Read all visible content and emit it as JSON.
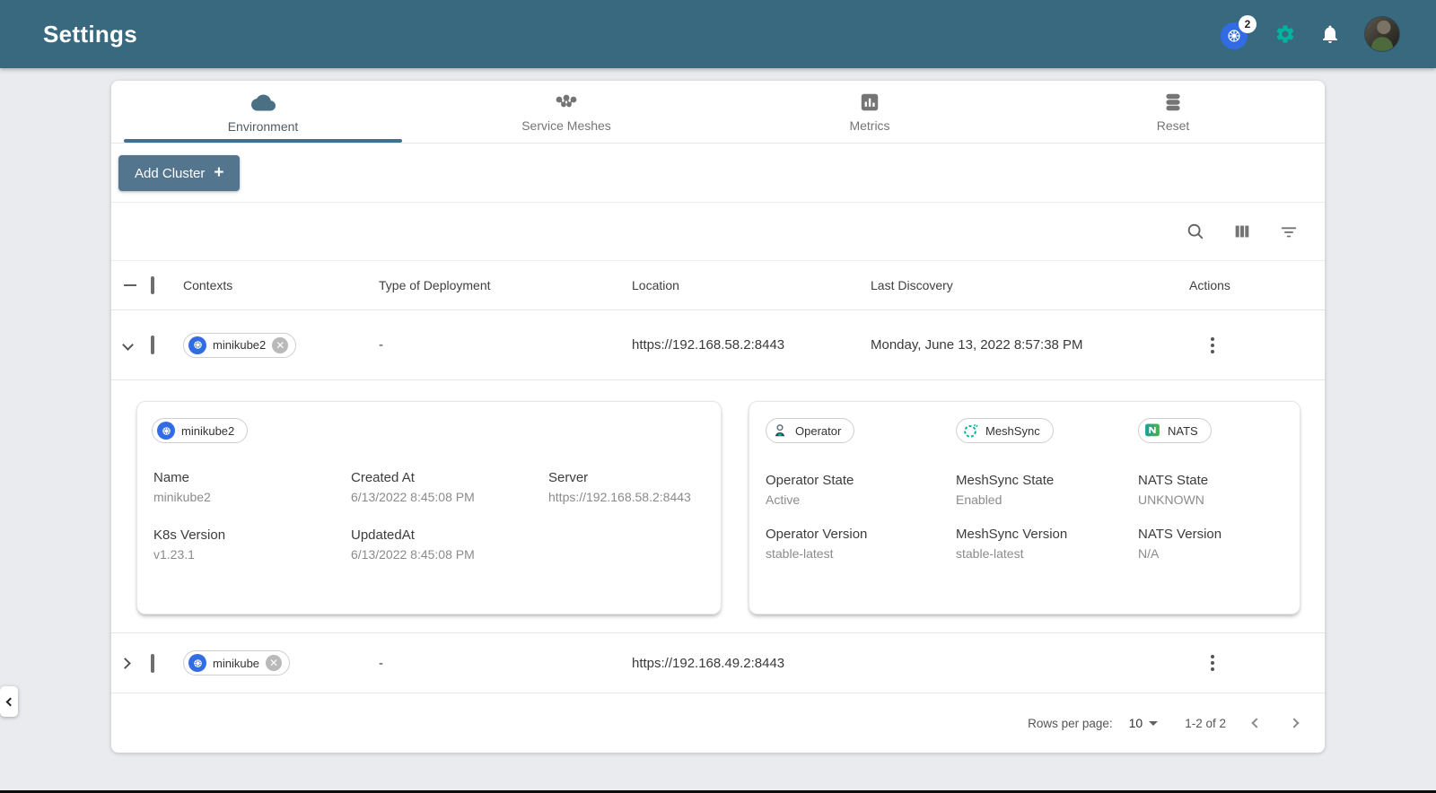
{
  "header": {
    "title": "Settings",
    "k8s_context_badge": "2"
  },
  "tabs": [
    {
      "label": "Environment",
      "active": true
    },
    {
      "label": "Service Meshes",
      "active": false
    },
    {
      "label": "Metrics",
      "active": false
    },
    {
      "label": "Reset",
      "active": false
    }
  ],
  "toolbar": {
    "add_cluster_label": "Add Cluster",
    "add_cluster_plus": "+"
  },
  "table": {
    "columns": [
      "Contexts",
      "Type of Deployment",
      "Location",
      "Last Discovery",
      "Actions"
    ],
    "rows": [
      {
        "context": "minikube2",
        "type_of_deployment": "-",
        "location": "https://192.168.58.2:8443",
        "last_discovery": "Monday, June 13, 2022 8:57:38 PM",
        "expanded": true
      },
      {
        "context": "minikube",
        "type_of_deployment": "-",
        "location": "https://192.168.49.2:8443",
        "last_discovery": "",
        "expanded": false
      }
    ]
  },
  "details": {
    "chip": "minikube2",
    "fields": [
      {
        "label": "Name",
        "value": "minikube2"
      },
      {
        "label": "Created At",
        "value": "6/13/2022 8:45:08 PM"
      },
      {
        "label": "Server",
        "value": "https://192.168.58.2:8443"
      },
      {
        "label": "K8s Version",
        "value": "v1.23.1"
      },
      {
        "label": "UpdatedAt",
        "value": "6/13/2022 8:45:08 PM"
      }
    ],
    "services": [
      {
        "chip": "Operator",
        "state_label": "Operator State",
        "state": "Active",
        "version_label": "Operator Version",
        "version": "stable-latest"
      },
      {
        "chip": "MeshSync",
        "state_label": "MeshSync State",
        "state": "Enabled",
        "version_label": "MeshSync Version",
        "version": "stable-latest"
      },
      {
        "chip": "NATS",
        "state_label": "NATS State",
        "state": "UNKNOWN",
        "version_label": "NATS Version",
        "version": "N/A"
      }
    ]
  },
  "pagination": {
    "rows_per_page_label": "Rows per page:",
    "rows_per_page": "10",
    "range": "1-2 of 2"
  },
  "icons": [
    "kubernetes-icon",
    "gear-icon",
    "bell-icon",
    "cloud-icon",
    "mesh-icon",
    "metrics-icon",
    "database-icon",
    "search-icon",
    "columns-icon",
    "filter-icon",
    "operator-icon",
    "meshsync-icon",
    "nats-icon",
    "kebab-icon",
    "close-icon"
  ],
  "colors": {
    "header_bg": "#38697e",
    "accent_teal": "#00B39F",
    "kubernetes_blue": "#326CE5",
    "nats_green": "#2BA362",
    "button_bg": "#53758e",
    "active_tab_underline": "#44708c"
  }
}
